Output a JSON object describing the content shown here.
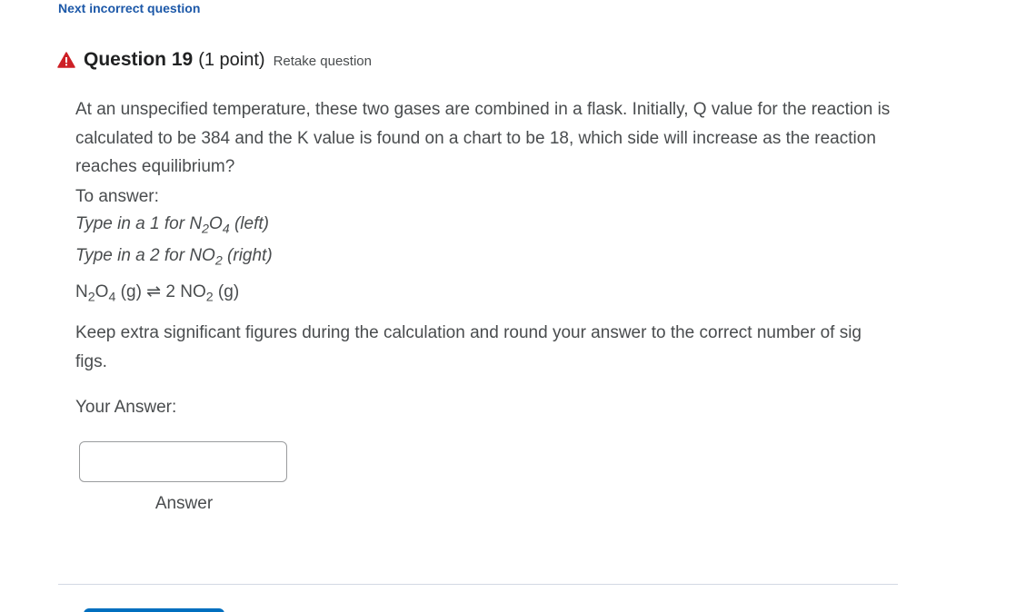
{
  "nav": {
    "next_incorrect": "Next incorrect question"
  },
  "question": {
    "title": "Question 19",
    "points": "(1 point)",
    "retake": "Retake question",
    "prompt": "At an unspecified temperature, these two gases are combined in a flask.  Initially, Q value for the reaction is calculated to be 384 and the K value is found on a chart to be 18, which side will increase as the reaction reaches equilibrium?",
    "to_answer": "To answer:",
    "option1": {
      "prefix": "Type in a 1 for N",
      "sub1": "2",
      "mid": "O",
      "sub2": "4",
      "suffix": " (left)"
    },
    "option2": {
      "prefix": "Type in a 2 for NO",
      "sub1": "2",
      "suffix": " (right)"
    },
    "equation": {
      "left_n": "N",
      "left_sub1": "2",
      "left_o": "O",
      "left_sub2": "4",
      "left_state": " (g) ",
      "arrow": "⇌",
      "right_coef": " 2 NO",
      "right_sub": "2",
      "right_state": " (g)"
    },
    "instructions": "Keep extra significant figures during the calculation and round your answer to the correct number of sig figs.",
    "your_answer": "Your Answer:",
    "answer_value": "",
    "answer_label": "Answer"
  },
  "colors": {
    "link": "#1c58a8",
    "warning": "#cd2026",
    "button": "#006fbf"
  },
  "icons": {
    "warning": "warning-triangle-icon"
  }
}
